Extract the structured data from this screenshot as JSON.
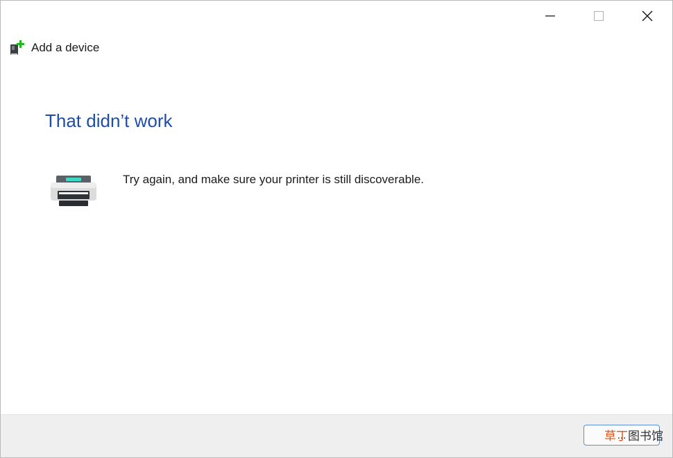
{
  "window": {
    "title": "Add a device",
    "controls": {
      "minimize": "minimize",
      "maximize": "maximize",
      "close": "close"
    }
  },
  "content": {
    "headline": "That didn’t work",
    "message": "Try again, and make sure your printer is still discoverable."
  },
  "footer": {
    "button_label": "..."
  },
  "watermark": {
    "accent": "草丁",
    "rest": "图书馆"
  },
  "colors": {
    "headline": "#1e4ea8",
    "footer_bg": "#efefef",
    "button_border": "#5a8fd6",
    "watermark_accent": "#e0561b"
  },
  "icons": {
    "app": "add-device-icon",
    "printer": "printer-icon"
  }
}
